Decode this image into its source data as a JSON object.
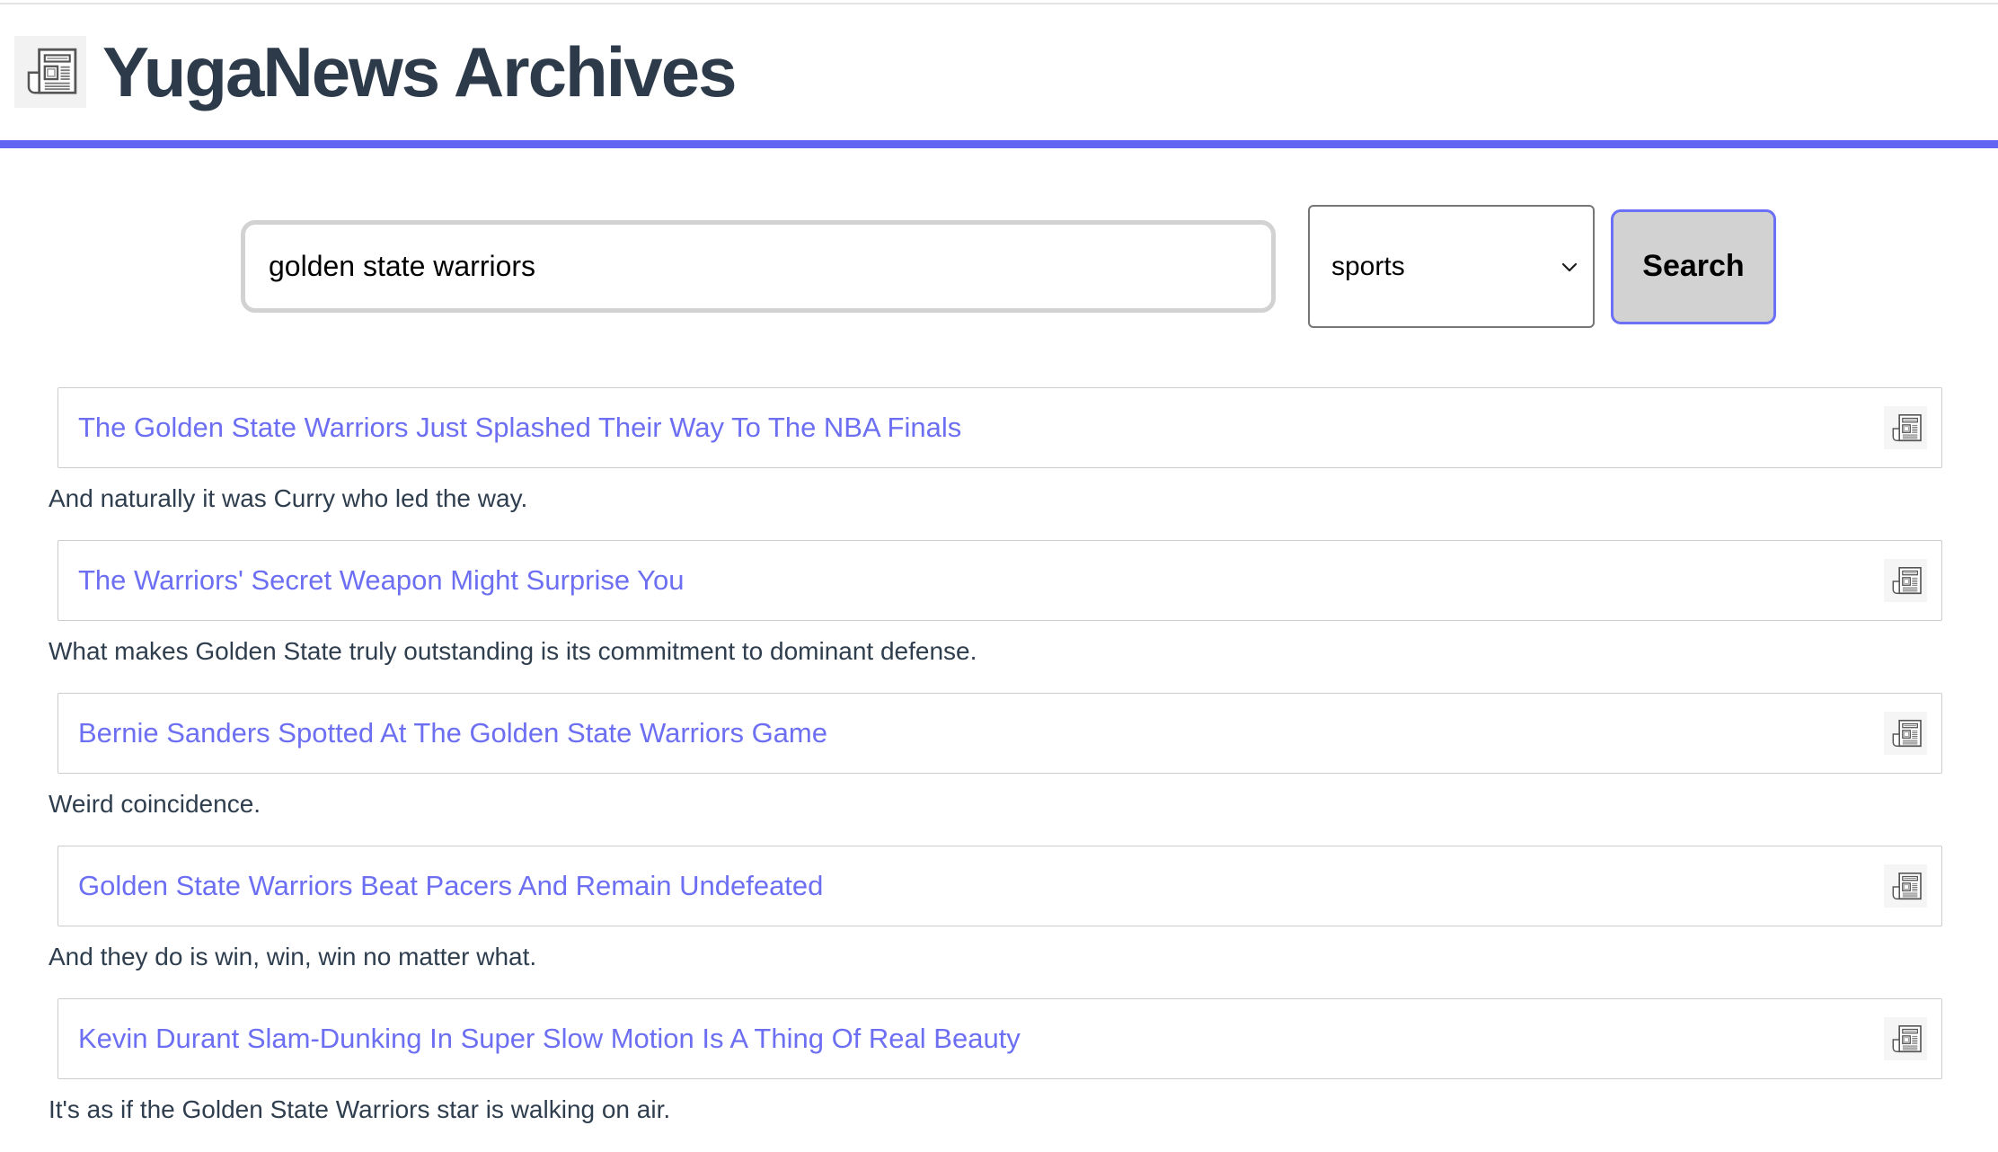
{
  "header": {
    "title": "YugaNews Archives"
  },
  "search": {
    "query": "golden state warriors",
    "category": "sports",
    "button_label": "Search"
  },
  "results": [
    {
      "title": "The Golden State Warriors Just Splashed Their Way To The NBA Finals",
      "description": "And naturally it was Curry who led the way."
    },
    {
      "title": "The Warriors' Secret Weapon Might Surprise You",
      "description": "What makes Golden State truly outstanding is its commitment to dominant defense."
    },
    {
      "title": "Bernie Sanders Spotted At The Golden State Warriors Game",
      "description": "Weird coincidence."
    },
    {
      "title": "Golden State Warriors Beat Pacers And Remain Undefeated",
      "description": "And they do is win, win, win no matter what."
    },
    {
      "title": "Kevin Durant Slam-Dunking In Super Slow Motion Is A Thing Of Real Beauty",
      "description": "It's as if the Golden State Warriors star is walking on air."
    }
  ],
  "icons": {
    "logo": "newspaper-icon",
    "result": "newspaper-icon",
    "dropdown": "chevron-down-icon"
  },
  "colors": {
    "accent_bar": "#6165f2",
    "link": "#6d6ff3",
    "heading_text": "#2c3a4a",
    "body_text": "#2f3e4e",
    "button_bg": "#d2d2d2",
    "button_border": "#6b70f5",
    "input_border": "#d2d2d2",
    "card_border": "#cccccc",
    "icon_chip_bg": "#f5f5f5"
  }
}
